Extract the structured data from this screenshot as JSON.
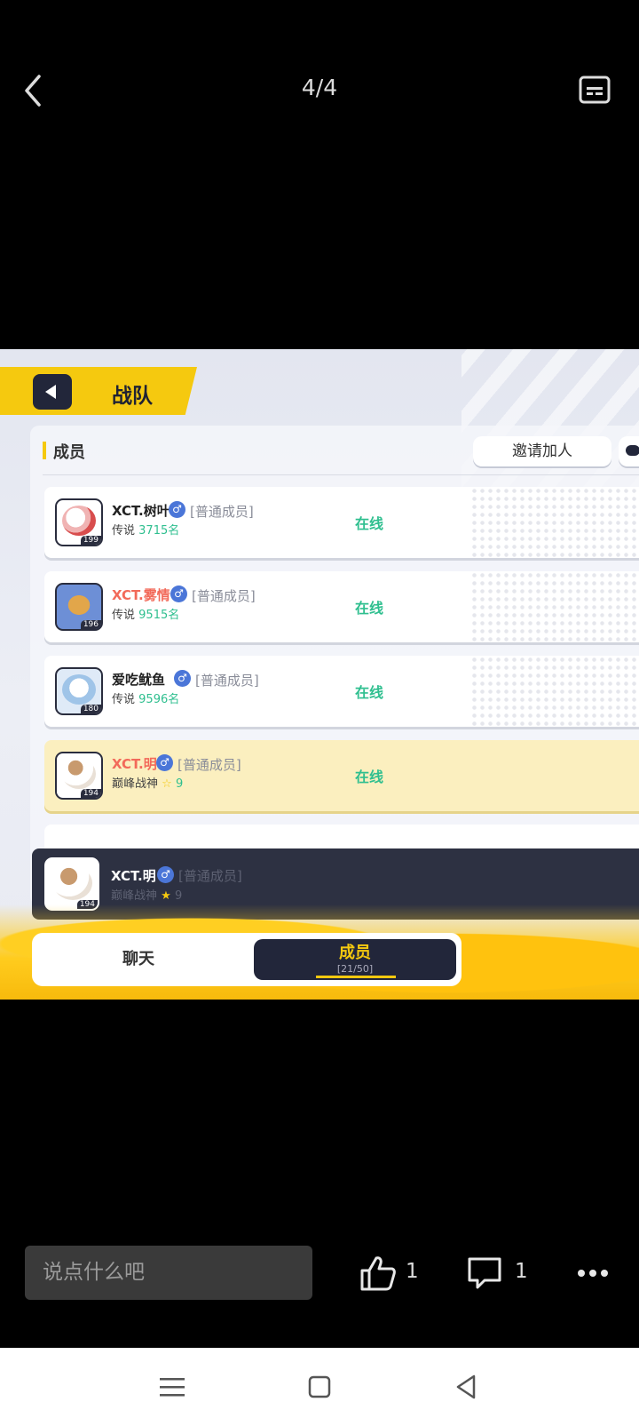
{
  "viewer": {
    "page_counter": "4/4",
    "comment_placeholder": "说点什么吧",
    "like_count": "1",
    "comment_count": "1"
  },
  "game": {
    "header_title": "战队",
    "section_title": "成员",
    "invite_label": "邀请加人",
    "members": [
      {
        "name": "XCT.树叶",
        "gender": "♂",
        "role": "[普通成员]",
        "title": "传说",
        "rank": "3715名",
        "level": "199",
        "status": "在线"
      },
      {
        "name": "XCT.雾情",
        "gender": "♂",
        "role": "[普通成员]",
        "title": "传说",
        "rank": "9515名",
        "level": "196",
        "status": "在线"
      },
      {
        "name": "爱吃鱿鱼",
        "gender": "♂",
        "role": "[普通成员]",
        "title": "传说",
        "rank": "9596名",
        "level": "180",
        "status": "在线"
      },
      {
        "name": "XCT.明",
        "gender": "♂",
        "role": "[普通成员]",
        "title": "巅峰战神",
        "rank": "9",
        "level": "194",
        "status": "在线"
      }
    ],
    "self": {
      "name": "XCT.明",
      "gender": "♂",
      "role": "[普通成员]",
      "title": "巅峰战神",
      "rank": "9",
      "level": "194"
    },
    "tabs": {
      "chat": "聊天",
      "members": "成员",
      "members_count": "[21/50]"
    }
  },
  "colors": {
    "accent": "#f5c90f",
    "online": "#2fbf8f",
    "dark": "#22263a"
  }
}
